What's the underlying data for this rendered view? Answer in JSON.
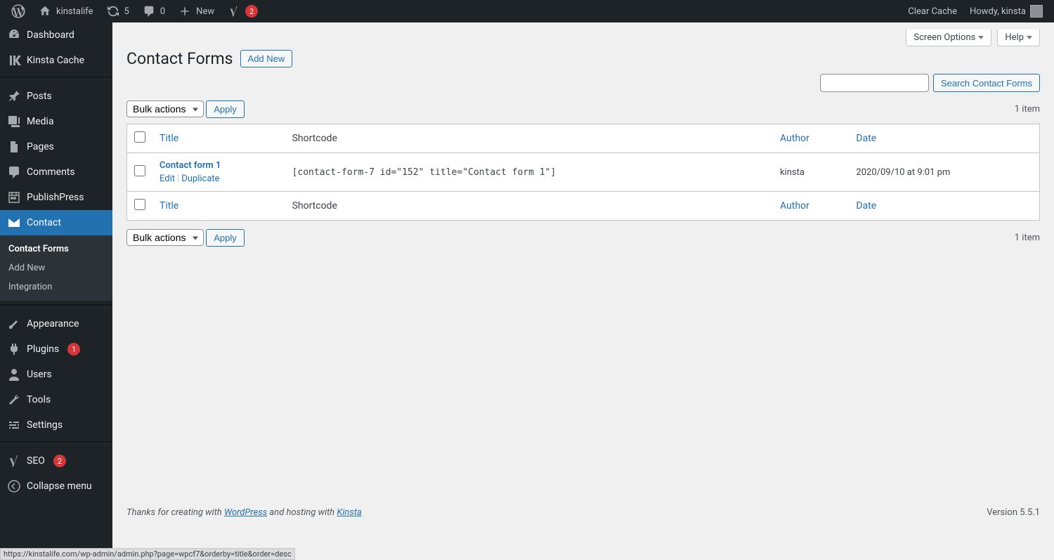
{
  "topbar": {
    "site_name": "kinstalife",
    "updates_count": "5",
    "comments_count": "0",
    "new_label": "New",
    "yoast_badge": "2",
    "clear_cache": "Clear Cache",
    "howdy": "Howdy, kinsta"
  },
  "sidebar": {
    "dashboard": "Dashboard",
    "kinsta_cache": "Kinsta Cache",
    "posts": "Posts",
    "media": "Media",
    "pages": "Pages",
    "comments": "Comments",
    "publishpress": "PublishPress",
    "contact": "Contact",
    "appearance": "Appearance",
    "plugins": "Plugins",
    "plugins_badge": "1",
    "users": "Users",
    "tools": "Tools",
    "settings": "Settings",
    "seo": "SEO",
    "seo_badge": "2",
    "collapse": "Collapse menu",
    "submenu": {
      "contact_forms": "Contact Forms",
      "add_new": "Add New",
      "integration": "Integration"
    }
  },
  "page": {
    "title": "Contact Forms",
    "add_new": "Add New",
    "screen_options": "Screen Options",
    "help": "Help",
    "search_button": "Search Contact Forms",
    "bulk_actions": "Bulk actions",
    "apply": "Apply",
    "items_count": "1 item",
    "columns": {
      "title": "Title",
      "shortcode": "Shortcode",
      "author": "Author",
      "date": "Date"
    },
    "rows": [
      {
        "title": "Contact form 1",
        "edit": "Edit",
        "duplicate": "Duplicate",
        "shortcode": "[contact-form-7 id=\"152\" title=\"Contact form 1\"]",
        "author": "kinsta",
        "date": "2020/09/10 at 9:01 pm"
      }
    ]
  },
  "footer": {
    "thanks_prefix": "Thanks for creating with ",
    "wordpress": "WordPress",
    "hosting_mid": " and hosting with ",
    "kinsta": "Kinsta",
    "version": "Version 5.5.1"
  },
  "status_url": "https://kinstalife.com/wp-admin/admin.php?page=wpcf7&orderby=title&order=desc"
}
